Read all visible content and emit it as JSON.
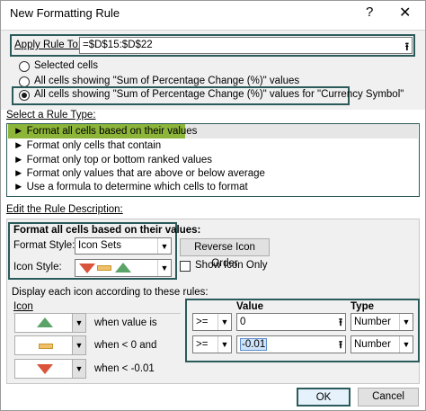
{
  "window": {
    "title": "New Formatting Rule",
    "help_glyph": "?",
    "close_glyph": "✕"
  },
  "apply": {
    "label": "Apply Rule To:",
    "value": "=$D$15:$D$22",
    "collapse_glyph": "⭱"
  },
  "scope": {
    "options": [
      "Selected cells",
      "All cells showing \"Sum of Percentage Change (%)\" values",
      "All cells showing \"Sum of Percentage Change (%)\" values for \"Currency Symbol\""
    ],
    "selected_index": 2
  },
  "rule_type": {
    "heading": "Select a Rule Type:",
    "bullet": "►",
    "items": [
      "Format all cells based on their values",
      "Format only cells that contain",
      "Format only top or bottom ranked values",
      "Format only values that are above or below average",
      "Use a formula to determine which cells to format"
    ],
    "selected_index": 0,
    "selected_color": "#8db53a"
  },
  "description": {
    "heading": "Edit the Rule Description:",
    "format_all_label": "Format all cells based on their values:",
    "format_style_label": "Format Style:",
    "format_style_value": "Icon Sets",
    "icon_style_label": "Icon Style:",
    "reverse_button": "Reverse Icon Order",
    "show_icon_only_label": "Show Icon Only",
    "show_icon_only_checked": false
  },
  "icons_section": {
    "heading": "Display each icon according to these rules:",
    "icon_col": "Icon",
    "value_col": "Value",
    "type_col": "Type",
    "rows": [
      {
        "icon": "green-triangle-up-icon",
        "text": "when value is",
        "operator": ">=",
        "value": "0",
        "type": "Number"
      },
      {
        "icon": "yellow-dash-icon",
        "text": "when < 0 and",
        "operator": ">=",
        "value": "-0.01",
        "type": "Number"
      },
      {
        "icon": "red-triangle-down-icon",
        "text": "when < -0.01",
        "operator": "",
        "value": "",
        "type": ""
      }
    ],
    "colors": {
      "up": "#5aa468",
      "mid": "#f0c06a",
      "down": "#d9543a"
    }
  },
  "buttons": {
    "ok": "OK",
    "cancel": "Cancel"
  }
}
